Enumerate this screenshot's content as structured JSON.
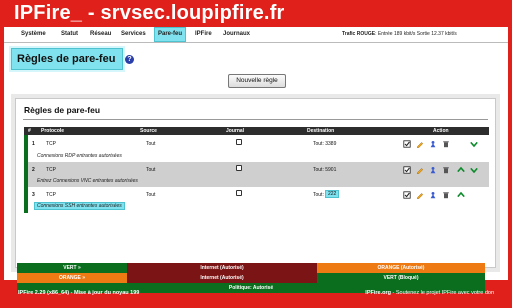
{
  "header": {
    "title": "IPFire_ - srvsec.loupipfire.fr"
  },
  "nav": {
    "items": [
      "Système",
      "Statut",
      "Réseau",
      "Services",
      "Pare-feu",
      "IPFire",
      "Journaux"
    ],
    "active": "Pare-feu",
    "traffic_label": "Trafic ROUGE",
    "traffic_in": "Entrée 189 kbit/s",
    "traffic_out": "Sortie 12.37 kbit/s"
  },
  "page": {
    "heading": "Règles de pare-feu",
    "help_icon": "question-circle-icon",
    "new_rule_button": "Nouvelle règle"
  },
  "rules_panel": {
    "title": "Règles de pare-feu",
    "columns": [
      "#",
      "Protocole",
      "Source",
      "Journal",
      "Destination",
      "Action"
    ],
    "rows": [
      {
        "num": "1",
        "protocol": "TCP",
        "source": "Tout",
        "destination": "Tout: 3389",
        "remark": "Connexions RDP entrantes autorisées"
      },
      {
        "num": "2",
        "protocol": "TCP",
        "source": "Tout",
        "destination": "Tout: 5901",
        "remark": "Entrez Connexions VNC entrantes autorisées"
      },
      {
        "num": "3",
        "protocol": "TCP",
        "source": "Tout",
        "destination_prefix": "Tout:",
        "destination_port": "222",
        "remark": "Connexions SSH entrantes autorisées"
      }
    ],
    "action_icons": [
      "checkbox-icon",
      "edit-pencil-icon",
      "copy-icon",
      "trash-icon",
      "arrow-up-icon",
      "arrow-down-icon"
    ],
    "colors": {
      "allow": "#0b6e1f",
      "internet": "#7b1414",
      "orange": "#ee7a14",
      "highlight": "#7fe2ee"
    }
  },
  "legend": {
    "green_to_internet": "VERT »",
    "internet_allowed_1": "Internet (Autorisé)",
    "orange_allowed": "ORANGE (Autorisé)",
    "orange_to_internet": "ORANGE »",
    "internet_allowed_2": "Internet (Autorisé)",
    "green_blocked": "VERT (Bloqué)",
    "policy": "Politique: Autorisé"
  },
  "footer": {
    "version": "IPFire 2.29 (x86_64) - Mise à jour du noyau 199",
    "site": "IPFire.org",
    "support_text": "Soutenez le projet IPFire avec votre don"
  }
}
